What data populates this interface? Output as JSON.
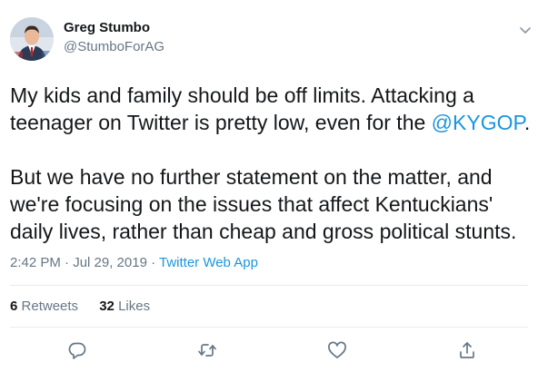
{
  "author": {
    "display_name": "Greg Stumbo",
    "handle": "@StumboForAG"
  },
  "tweet": {
    "text_p1": "My kids and family should be off limits. Attacking a teenager on Twitter is pretty low, even for the ",
    "mention": "@KYGOP",
    "text_p1_end": ".",
    "text_p2": "But we have no further statement on the matter, and we're focusing on the issues that affect Kentuckians' daily lives, rather than cheap and gross political stunts."
  },
  "meta": {
    "timestamp": "2:42 PM · Jul 29, 2019 · ",
    "source": "Twitter Web App"
  },
  "stats": {
    "retweets_count": "6",
    "retweets_label": "Retweets",
    "likes_count": "32",
    "likes_label": "Likes"
  },
  "colors": {
    "link": "#1b95e0",
    "secondary": "#657786",
    "primary": "#14171a"
  },
  "icons": [
    "chevron-down-icon",
    "reply-icon",
    "retweet-icon",
    "like-icon",
    "share-icon"
  ]
}
